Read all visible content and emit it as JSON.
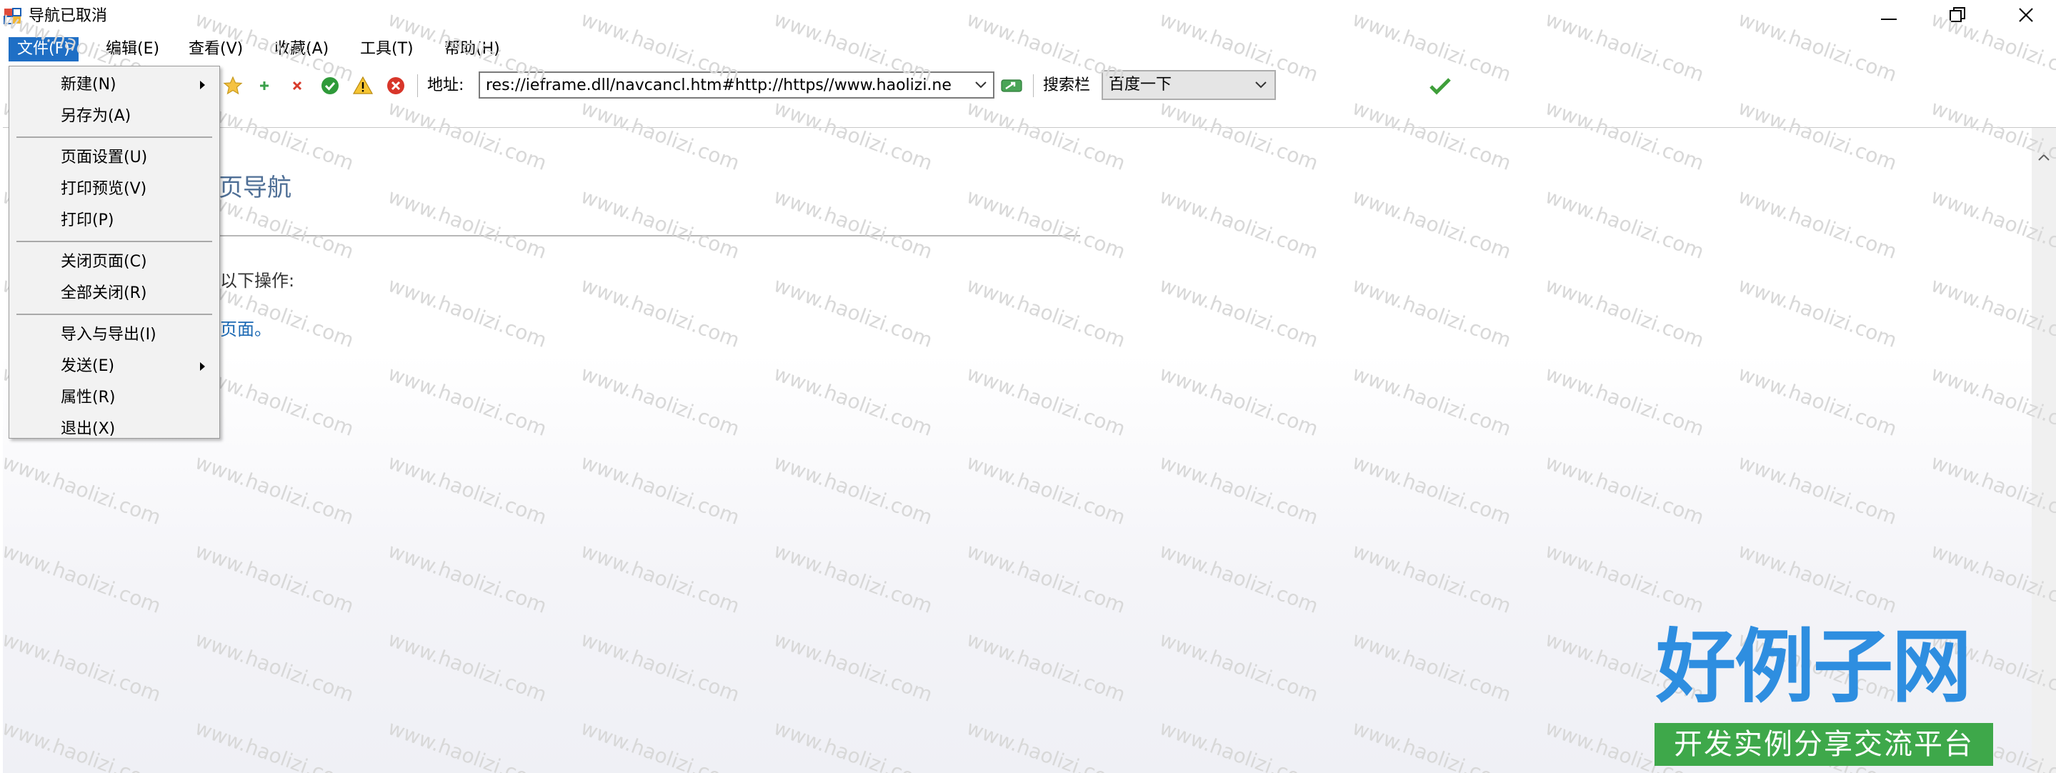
{
  "window": {
    "title": "导航已取消",
    "controls": [
      "minimize-icon",
      "restore-icon",
      "close-icon"
    ]
  },
  "menubar": {
    "items": [
      {
        "label": "文件(F)",
        "active": true
      },
      {
        "label": "编辑(E)"
      },
      {
        "label": "查看(V)"
      },
      {
        "label": "收藏(A)"
      },
      {
        "label": "工具(T)"
      },
      {
        "label": "帮助(H)"
      }
    ]
  },
  "toolbar": {
    "icons": [
      "favorites-star-icon",
      "add-icon",
      "remove-icon",
      "ok-icon",
      "warning-icon",
      "stop-icon"
    ],
    "address_label": "地址:",
    "address_value": "res://ieframe.dll/navcancl.htm#http://https//www.haolizi.ne",
    "go_icon": "go-icon",
    "search_label": "搜索栏",
    "search_engine": "百度一下",
    "search_value": "",
    "search_go_icon": "checkmark-icon"
  },
  "content": {
    "heading": "页导航",
    "text": "以下操作:",
    "link": "页面。"
  },
  "file_menu": {
    "items": [
      {
        "label": "新建(N)",
        "submenu": true
      },
      {
        "label": "另存为(A)"
      },
      {
        "separator": true
      },
      {
        "label": "页面设置(U)"
      },
      {
        "label": "打印预览(V)"
      },
      {
        "label": "打印(P)"
      },
      {
        "separator": true
      },
      {
        "label": "关闭页面(C)"
      },
      {
        "label": "全部关闭(R)"
      },
      {
        "separator": true
      },
      {
        "label": "导入与导出(I)"
      },
      {
        "label": "发送(E)",
        "submenu": true
      },
      {
        "label": "属性(R)"
      },
      {
        "label": "退出(X)"
      }
    ]
  },
  "watermark": {
    "text": "www.haolizi.com",
    "logo_main": "好例子网",
    "logo_sub": "开发实例分享交流平台"
  },
  "colors": {
    "menu_active": "#1f6fc5",
    "heading": "#4f6f96",
    "link": "#1a68b3",
    "logo_blue": "#2e8ee0",
    "logo_green": "#3ea84a"
  }
}
